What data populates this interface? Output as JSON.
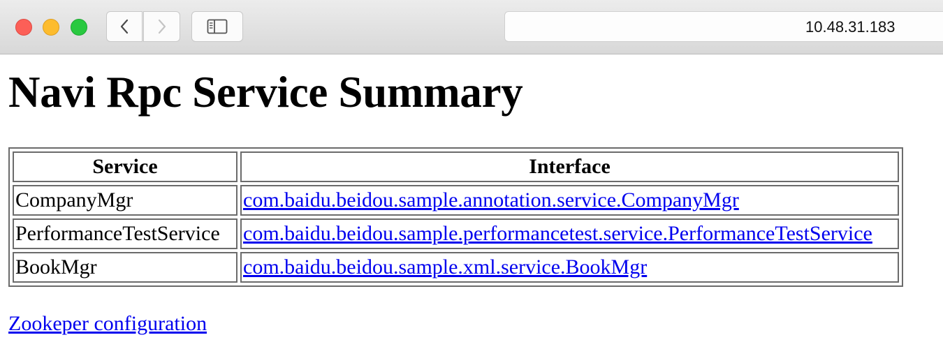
{
  "browser": {
    "url": "10.48.31.183",
    "icons": {
      "close": "close-window-light",
      "minimize": "minimize-window-light",
      "zoom": "zoom-window-light",
      "back": "chevron-left-icon",
      "forward": "chevron-right-icon",
      "sidebar": "sidebar-icon"
    },
    "colors": {
      "close": "#fc5f57",
      "minimize": "#fdbc2e",
      "zoom": "#29c940"
    }
  },
  "page": {
    "title": "Navi Rpc Service Summary",
    "table": {
      "headers": [
        "Service",
        "Interface"
      ],
      "rows": [
        {
          "service": "CompanyMgr",
          "interface": "com.baidu.beidou.sample.annotation.service.CompanyMgr"
        },
        {
          "service": "PerformanceTestService",
          "interface": "com.baidu.beidou.sample.performancetest.service.PerformanceTestService"
        },
        {
          "service": "BookMgr",
          "interface": "com.baidu.beidou.sample.xml.service.BookMgr"
        }
      ]
    },
    "footer_link": "Zookeper configuration",
    "link_color": "#0000ee"
  }
}
